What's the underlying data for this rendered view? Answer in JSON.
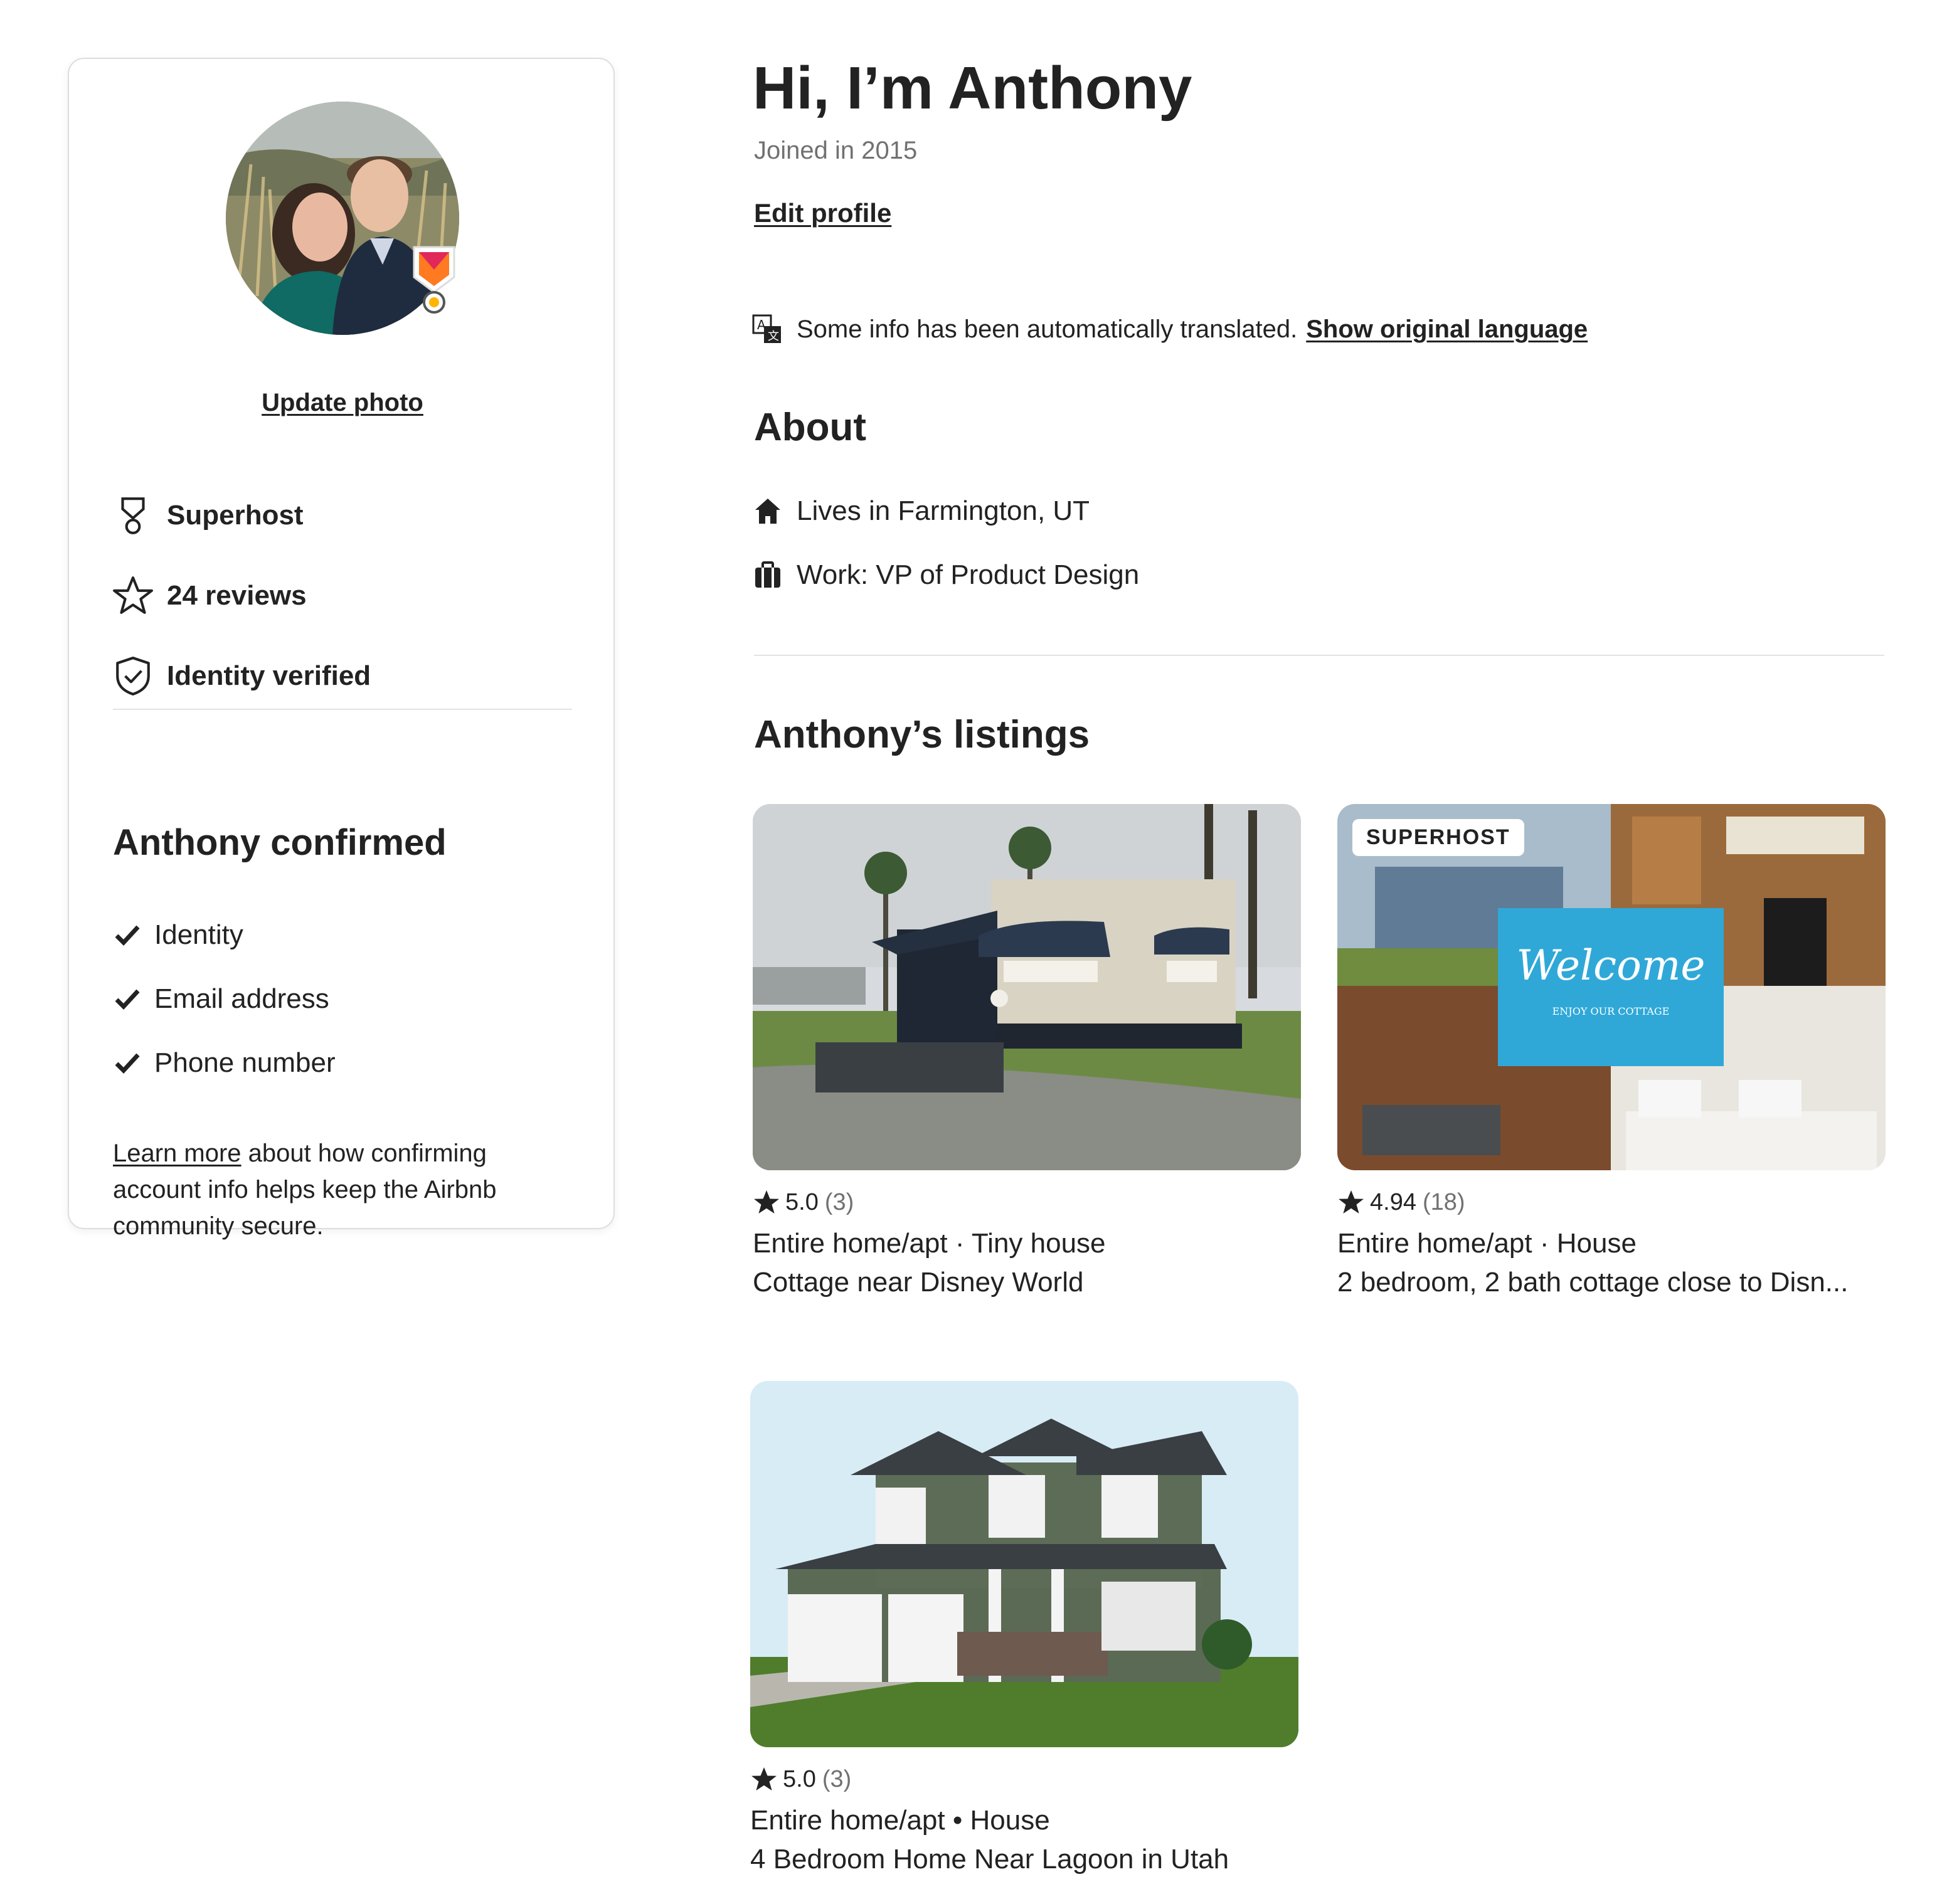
{
  "profile": {
    "update_photo_label": "Update photo",
    "stats": {
      "superhost": "Superhost",
      "reviews": "24 reviews",
      "identity": "Identity verified"
    },
    "confirmed": {
      "title": "Anthony confirmed",
      "items": [
        "Identity",
        "Email address",
        "Phone number"
      ]
    },
    "learn_more": {
      "link": "Learn more",
      "text": " about how confirming account info helps keep the Airbnb community secure."
    }
  },
  "header": {
    "greeting": "Hi, I’m Anthony",
    "joined": "Joined in 2015",
    "edit_profile": "Edit profile"
  },
  "translation": {
    "notice": "Some info has been automatically translated.",
    "link": "Show original language"
  },
  "about": {
    "title": "About",
    "lives": "Lives in Farmington, UT",
    "work": "Work: VP of Product Design"
  },
  "listings": {
    "title": "Anthony’s listings",
    "items": [
      {
        "rating": "5.0",
        "reviews": "(3)",
        "type": "Entire home/apt · Tiny house",
        "name": "Cottage near Disney World",
        "tag": ""
      },
      {
        "rating": "4.94",
        "reviews": "(18)",
        "type": "Entire home/apt · House",
        "name": "2 bedroom, 2 bath cottage close to Disn...",
        "tag": "SUPERHOST",
        "welcome": "Welcome",
        "welcome_sub": "ENJOY OUR COTTAGE"
      },
      {
        "rating": "5.0",
        "reviews": "(3)",
        "type": "Entire home/apt • House",
        "name": "4 Bedroom Home Near Lagoon in Utah",
        "tag": ""
      }
    ]
  },
  "icons": {
    "superhost": "superhost-medal-icon",
    "reviews": "star-outline-icon",
    "identity": "shield-check-icon",
    "check": "checkmark-icon",
    "translate": "translate-icon",
    "home": "home-icon",
    "work": "briefcase-icon",
    "rating": "star-filled-icon"
  },
  "colors": {
    "text": "#222222",
    "muted": "#717171",
    "divider": "#e3e3e3",
    "superhost_badge": "#e0285a",
    "welcome_bg": "#2fa8d8"
  }
}
